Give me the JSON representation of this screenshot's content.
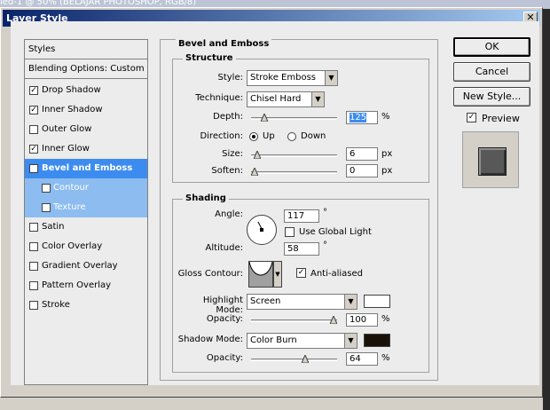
{
  "background": {
    "doc_title": "led-1 @ 50% (BELAJAR PHOTOSHOP, RGB/8)"
  },
  "window": {
    "title": "Layer Style",
    "close": "✕"
  },
  "sidebar": {
    "header": "Styles",
    "blending": "Blending Options: Custom",
    "items": [
      {
        "label": "Drop Shadow",
        "checked": "✓"
      },
      {
        "label": "Inner Shadow",
        "checked": "✓"
      },
      {
        "label": "Outer Glow",
        "checked": ""
      },
      {
        "label": "Inner Glow",
        "checked": "✓"
      },
      {
        "label": "Bevel and Emboss",
        "checked": "✓"
      },
      {
        "label": "Contour",
        "checked": ""
      },
      {
        "label": "Texture",
        "checked": ""
      },
      {
        "label": "Satin",
        "checked": ""
      },
      {
        "label": "Color Overlay",
        "checked": ""
      },
      {
        "label": "Gradient Overlay",
        "checked": ""
      },
      {
        "label": "Pattern Overlay",
        "checked": ""
      },
      {
        "label": "Stroke",
        "checked": ""
      }
    ]
  },
  "bevel": {
    "section": "Bevel and Emboss",
    "structure": {
      "title": "Structure",
      "style_label": "Style:",
      "style_value": "Stroke Emboss",
      "technique_label": "Technique:",
      "technique_value": "Chisel Hard",
      "depth_label": "Depth:",
      "depth_value": "125",
      "depth_unit": "%",
      "depth_level": 0.12,
      "direction_label": "Direction:",
      "up_label": "Up",
      "down_label": "Down",
      "size_label": "Size:",
      "size_value": "6",
      "size_unit": "px",
      "size_level": 0.03,
      "soften_label": "Soften:",
      "soften_value": "0",
      "soften_unit": "px",
      "soften_level": 0.0
    },
    "shading": {
      "title": "Shading",
      "angle_label": "Angle:",
      "angle_value": "117",
      "angle_unit": "°",
      "global_light_label": "Use Global Light",
      "global_light_checked": "",
      "altitude_label": "Altitude:",
      "altitude_value": "58",
      "altitude_unit": "°",
      "gloss_label": "Gloss Contour:",
      "antialias_label": "Anti-aliased",
      "antialias_checked": "✓",
      "highlight_label": "Highlight Mode:",
      "highlight_value": "Screen",
      "highlight_color": "#ffffff",
      "highlight_opacity_label": "Opacity:",
      "highlight_opacity_value": "100",
      "highlight_opacity_unit": "%",
      "highlight_opacity_level": 1.0,
      "shadow_label": "Shadow Mode:",
      "shadow_value": "Color Burn",
      "shadow_color": "#1a1209",
      "shadow_opacity_label": "Opacity:",
      "shadow_opacity_value": "64",
      "shadow_opacity_unit": "%",
      "shadow_opacity_level": 0.64
    }
  },
  "buttons": {
    "ok": "OK",
    "cancel": "Cancel",
    "new_style": "New Style...",
    "preview": "Preview",
    "preview_checked": "✓"
  }
}
